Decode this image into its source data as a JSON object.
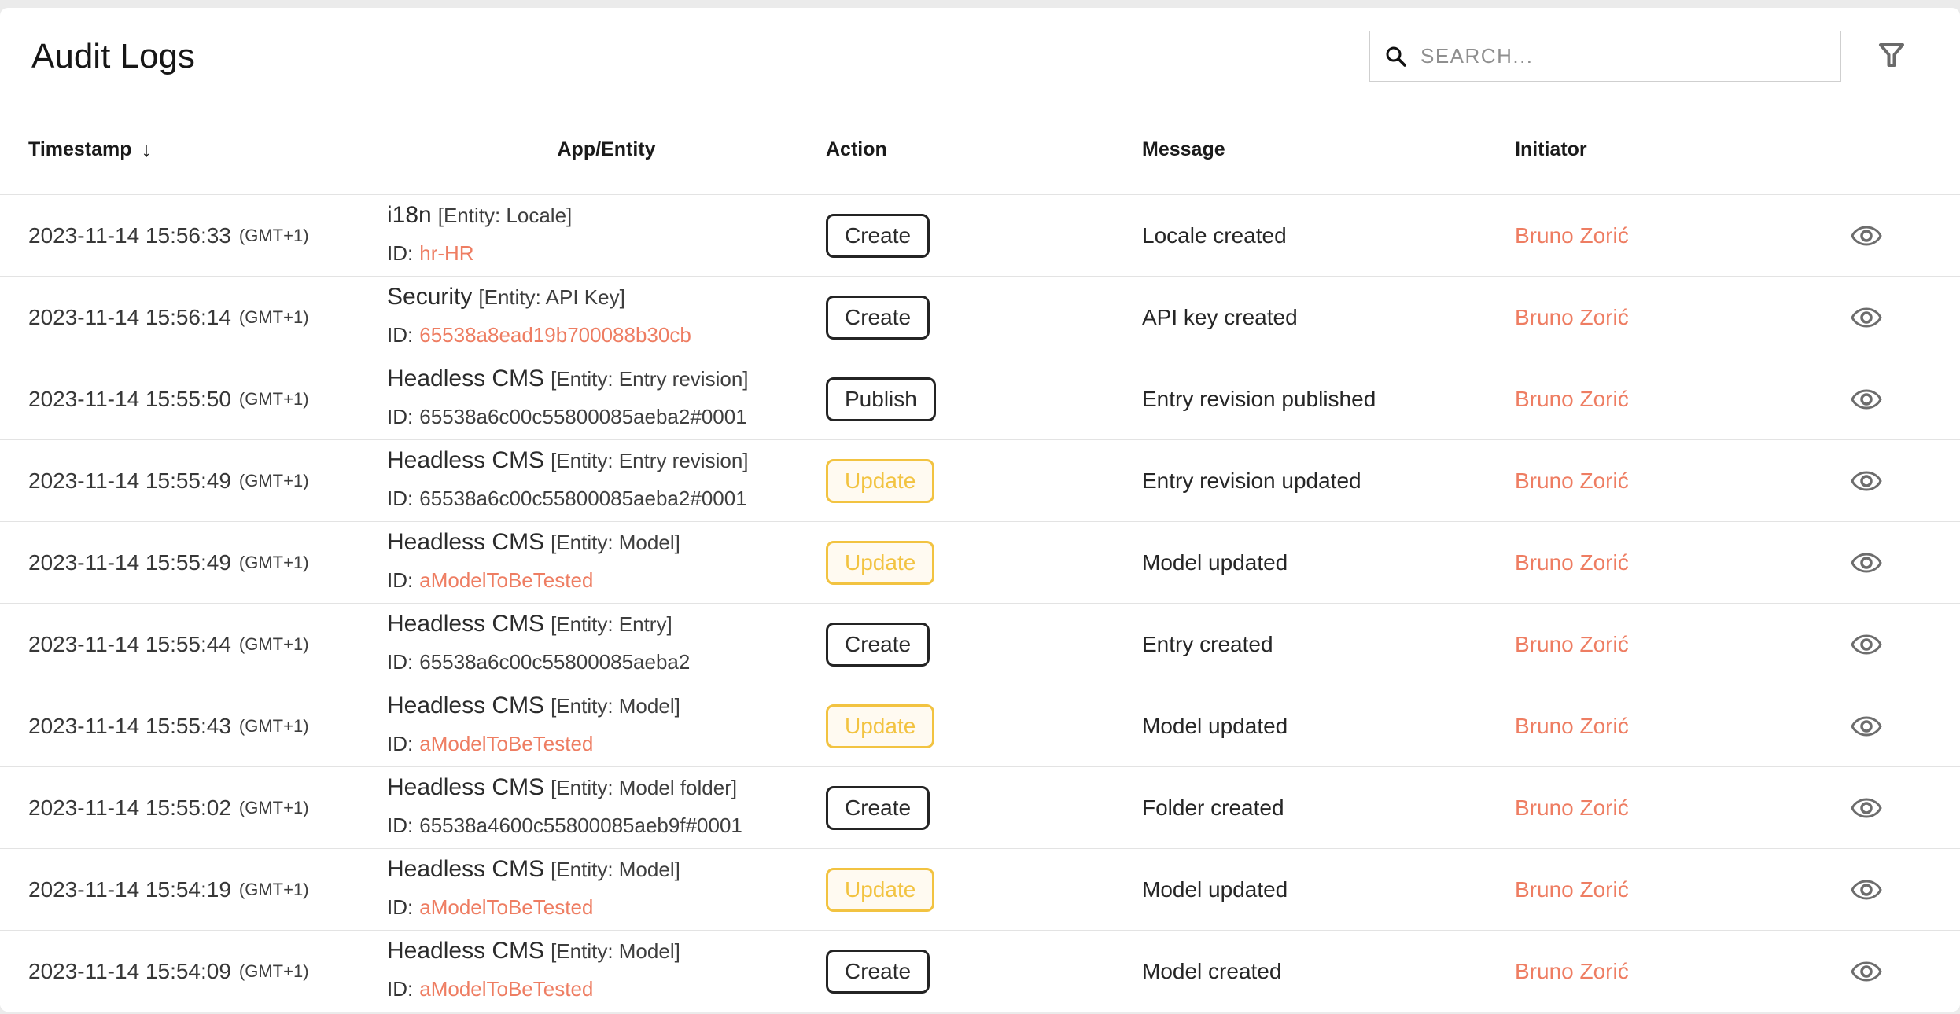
{
  "header": {
    "title": "Audit Logs",
    "search_placeholder": "SEARCH..."
  },
  "table": {
    "columns": {
      "timestamp": "Timestamp",
      "sort_icon": "↓",
      "app_entity": "App/Entity",
      "action": "Action",
      "message": "Message",
      "initiator": "Initiator"
    }
  },
  "labels": {
    "id_prefix": "ID:"
  },
  "colors": {
    "accent": "#ee7d62",
    "warning": "#f2c341",
    "warning-bg": "#fffaf1",
    "dark": "#242424",
    "icon-gray": "#6d6d6d"
  },
  "rows": [
    {
      "timestamp": "2023-11-14 15:56:33",
      "tz": "(GMT+1)",
      "app": "i18n",
      "entity": "[Entity: Locale]",
      "id": "hr-HR",
      "id_kind": "link",
      "action": "Create",
      "action_variant": "default",
      "message": "Locale created",
      "initiator": "Bruno Zorić"
    },
    {
      "timestamp": "2023-11-14 15:56:14",
      "tz": "(GMT+1)",
      "app": "Security",
      "entity": "[Entity: API Key]",
      "id": "65538a8ead19b700088b30cb",
      "id_kind": "link",
      "action": "Create",
      "action_variant": "default",
      "message": "API key created",
      "initiator": "Bruno Zorić"
    },
    {
      "timestamp": "2023-11-14 15:55:50",
      "tz": "(GMT+1)",
      "app": "Headless CMS",
      "entity": "[Entity: Entry revision]",
      "id": "65538a6c00c55800085aeba2#0001",
      "id_kind": "plain",
      "action": "Publish",
      "action_variant": "default",
      "message": "Entry revision published",
      "initiator": "Bruno Zorić"
    },
    {
      "timestamp": "2023-11-14 15:55:49",
      "tz": "(GMT+1)",
      "app": "Headless CMS",
      "entity": "[Entity: Entry revision]",
      "id": "65538a6c00c55800085aeba2#0001",
      "id_kind": "plain",
      "action": "Update",
      "action_variant": "warning",
      "message": "Entry revision updated",
      "initiator": "Bruno Zorić"
    },
    {
      "timestamp": "2023-11-14 15:55:49",
      "tz": "(GMT+1)",
      "app": "Headless CMS",
      "entity": "[Entity: Model]",
      "id": "aModelToBeTested",
      "id_kind": "link",
      "action": "Update",
      "action_variant": "warning",
      "message": "Model updated",
      "initiator": "Bruno Zorić"
    },
    {
      "timestamp": "2023-11-14 15:55:44",
      "tz": "(GMT+1)",
      "app": "Headless CMS",
      "entity": "[Entity: Entry]",
      "id": "65538a6c00c55800085aeba2",
      "id_kind": "plain",
      "action": "Create",
      "action_variant": "default",
      "message": "Entry created",
      "initiator": "Bruno Zorić"
    },
    {
      "timestamp": "2023-11-14 15:55:43",
      "tz": "(GMT+1)",
      "app": "Headless CMS",
      "entity": "[Entity: Model]",
      "id": "aModelToBeTested",
      "id_kind": "link",
      "action": "Update",
      "action_variant": "warning",
      "message": "Model updated",
      "initiator": "Bruno Zorić"
    },
    {
      "timestamp": "2023-11-14 15:55:02",
      "tz": "(GMT+1)",
      "app": "Headless CMS",
      "entity": "[Entity: Model folder]",
      "id": "65538a4600c55800085aeb9f#0001",
      "id_kind": "plain",
      "action": "Create",
      "action_variant": "default",
      "message": "Folder created",
      "initiator": "Bruno Zorić"
    },
    {
      "timestamp": "2023-11-14 15:54:19",
      "tz": "(GMT+1)",
      "app": "Headless CMS",
      "entity": "[Entity: Model]",
      "id": "aModelToBeTested",
      "id_kind": "link",
      "action": "Update",
      "action_variant": "warning",
      "message": "Model updated",
      "initiator": "Bruno Zorić"
    },
    {
      "timestamp": "2023-11-14 15:54:09",
      "tz": "(GMT+1)",
      "app": "Headless CMS",
      "entity": "[Entity: Model]",
      "id": "aModelToBeTested",
      "id_kind": "link",
      "action": "Create",
      "action_variant": "default",
      "message": "Model created",
      "initiator": "Bruno Zorić"
    }
  ]
}
